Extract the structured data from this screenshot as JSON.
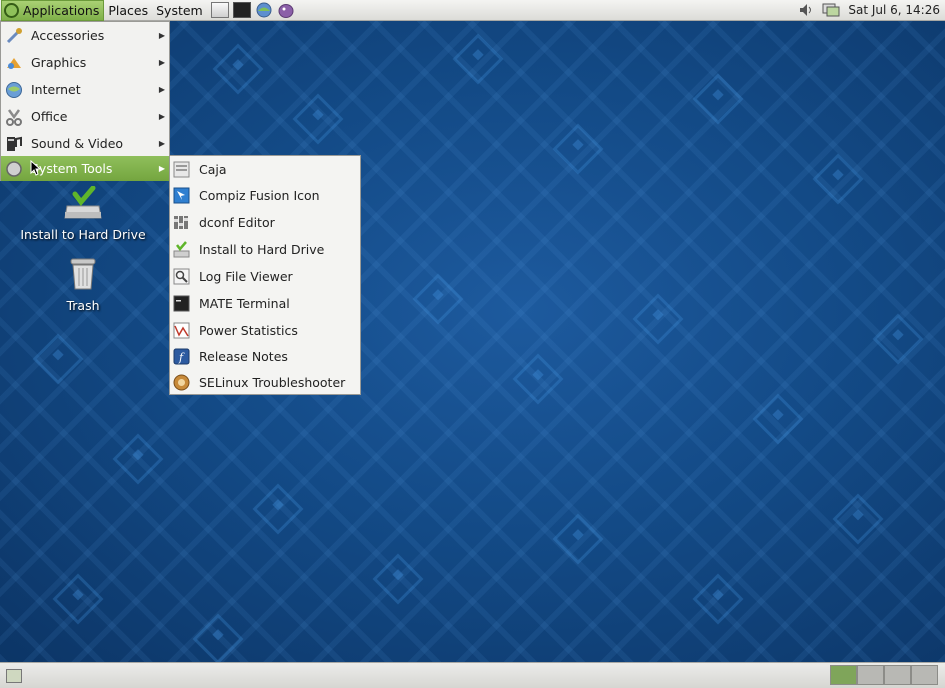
{
  "top_panel": {
    "menus": [
      "Applications",
      "Places",
      "System"
    ],
    "clock": "Sat Jul  6, 14:26"
  },
  "applications_menu": {
    "items": [
      {
        "label": "Accessories",
        "icon": "accessories-icon"
      },
      {
        "label": "Graphics",
        "icon": "graphics-icon"
      },
      {
        "label": "Internet",
        "icon": "internet-icon"
      },
      {
        "label": "Office",
        "icon": "office-icon"
      },
      {
        "label": "Sound & Video",
        "icon": "sound-video-icon"
      },
      {
        "label": "System Tools",
        "icon": "system-tools-icon"
      }
    ]
  },
  "system_tools_submenu": {
    "items": [
      {
        "label": "Caja",
        "icon": "caja-icon"
      },
      {
        "label": "Compiz Fusion Icon",
        "icon": "compiz-icon"
      },
      {
        "label": "dconf Editor",
        "icon": "dconf-icon"
      },
      {
        "label": "Install to Hard Drive",
        "icon": "install-icon"
      },
      {
        "label": "Log File Viewer",
        "icon": "log-viewer-icon"
      },
      {
        "label": "MATE Terminal",
        "icon": "terminal-icon"
      },
      {
        "label": "Power Statistics",
        "icon": "power-stats-icon"
      },
      {
        "label": "Release Notes",
        "icon": "release-notes-icon"
      },
      {
        "label": "SELinux Troubleshooter",
        "icon": "selinux-icon"
      }
    ]
  },
  "desktop_icons": [
    {
      "label": "Install to Hard Drive",
      "icon": "install-drive-icon"
    },
    {
      "label": "Trash",
      "icon": "trash-icon"
    }
  ],
  "colors": {
    "menu_highlight": "#7fb049",
    "desktop_blue": "#134a86"
  }
}
